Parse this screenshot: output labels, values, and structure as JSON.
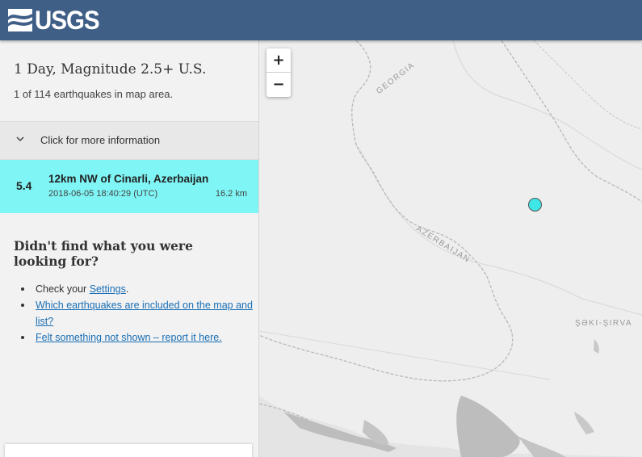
{
  "header": {
    "logo_text": "USGS"
  },
  "sidebar": {
    "title": "1 Day, Magnitude 2.5+ U.S.",
    "count_text": "1 of 114 earthquakes in map area.",
    "more_info_label": "Click for more information",
    "earthquake": {
      "magnitude": "5.4",
      "place": "12km NW of Cinarli, Azerbaijan",
      "time": "2018-06-05 18:40:29 (UTC)",
      "depth": "16.2 km"
    },
    "help": {
      "title": "Didn't find what you were looking for?",
      "check_prefix": "Check your ",
      "settings_link": "Settings",
      "check_suffix": ".",
      "included_link": "Which earthquakes are included on the map and list?",
      "felt_link": "Felt something not shown – report it here."
    }
  },
  "map": {
    "zoom_in": "+",
    "zoom_out": "−",
    "labels": {
      "georgia": "GEORGIA",
      "azerbaijan": "AZERBAIJAN",
      "region": "ŞƏKI-ŞIRVA"
    },
    "marker_color": "#3fe6e6"
  },
  "colors": {
    "header": "#3f5f86",
    "highlight": "#7ff5f5",
    "link": "#1a6fb5"
  }
}
